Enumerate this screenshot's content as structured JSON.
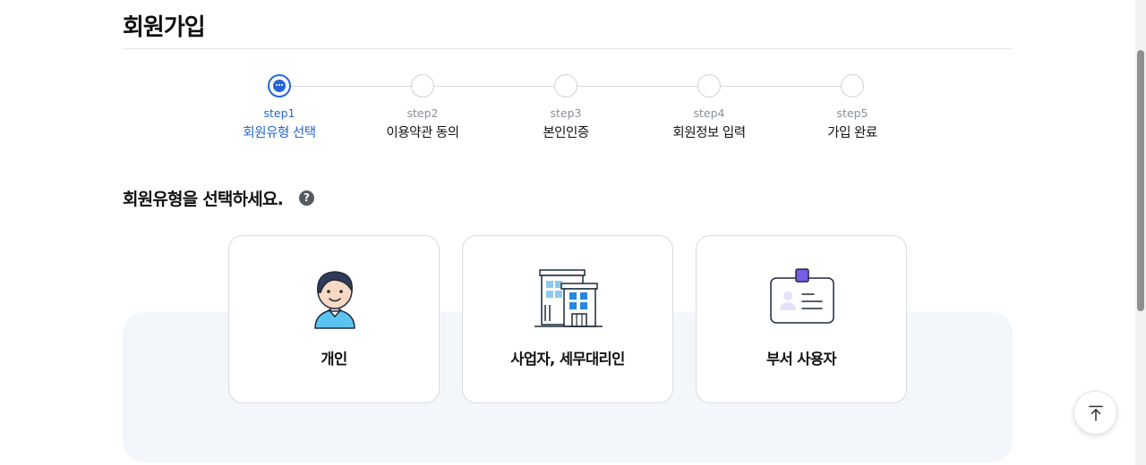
{
  "page": {
    "title": "회원가입"
  },
  "stepper": {
    "steps": [
      {
        "num": "step1",
        "label": "회원유형 선택",
        "active": true
      },
      {
        "num": "step2",
        "label": "이용약관 동의",
        "active": false
      },
      {
        "num": "step3",
        "label": "본인인증",
        "active": false
      },
      {
        "num": "step4",
        "label": "회원정보 입력",
        "active": false
      },
      {
        "num": "step5",
        "label": "가입 완료",
        "active": false
      }
    ]
  },
  "section": {
    "heading": "회원유형을 선택하세요.",
    "help_icon": "?"
  },
  "member_types": [
    {
      "label": "개인",
      "icon": "person-icon"
    },
    {
      "label": "사업자, 세무대리인",
      "icon": "building-icon"
    },
    {
      "label": "부서 사용자",
      "icon": "id-badge-icon"
    }
  ],
  "colors": {
    "accent": "#2565d6",
    "panel": "#f3f6fb",
    "border": "#d8dbe0"
  }
}
